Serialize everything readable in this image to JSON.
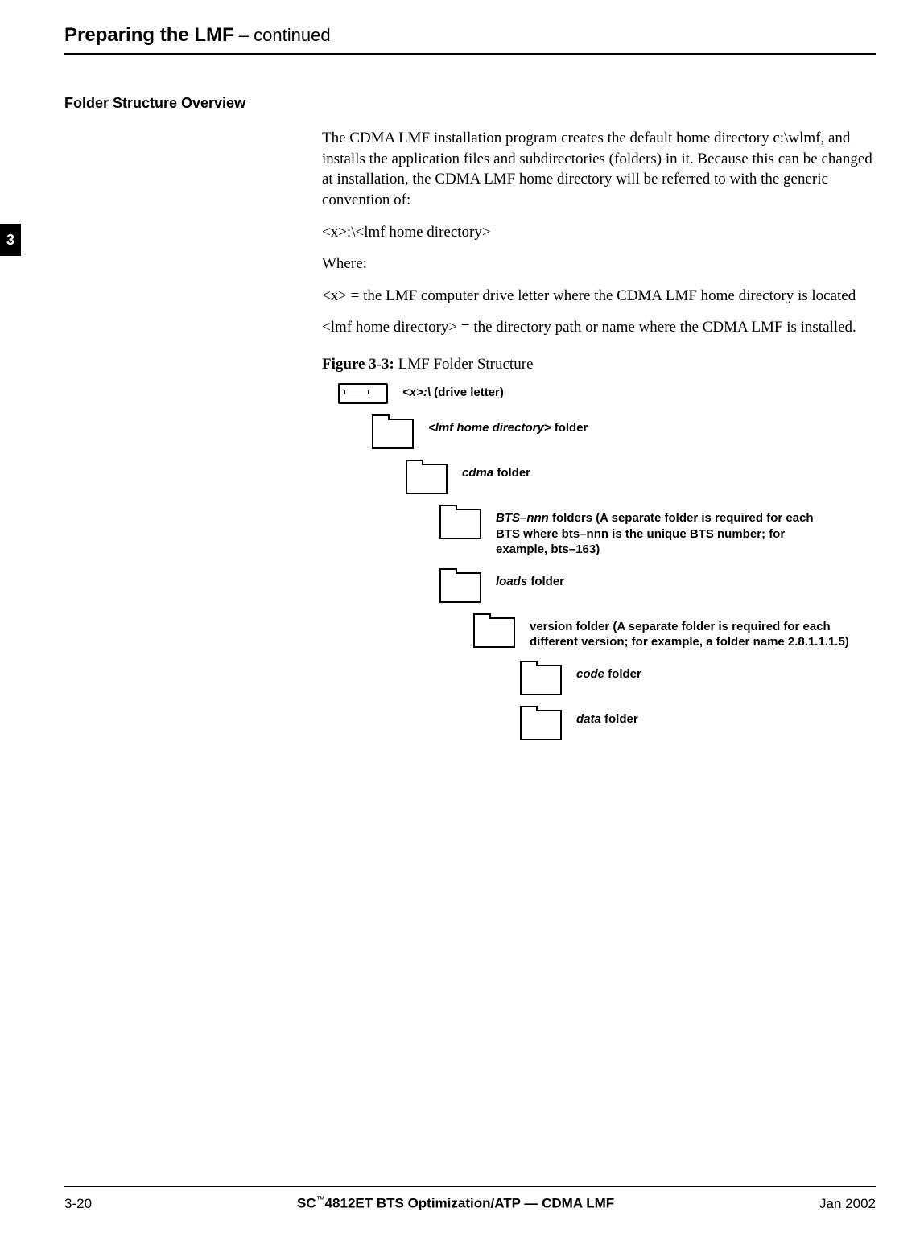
{
  "header": {
    "title": "Preparing the LMF",
    "continued": "  – continued"
  },
  "chapter_tab": "3",
  "section": {
    "title": "Folder Structure Overview",
    "p1": "The CDMA LMF installation program creates the default home directory c:\\wlmf, and installs the application files and subdirectories (folders) in it. Because this can be changed at installation, the CDMA LMF home directory will be referred to with the generic convention of:",
    "p2": "<x>:\\<lmf home directory>",
    "p3": "Where:",
    "p4": "<x> = the LMF computer drive letter where the CDMA LMF home directory is located",
    "p5": "<lmf home directory> = the directory path or name where the CDMA LMF is installed."
  },
  "figure": {
    "caption_bold": "Figure 3-3:",
    "caption_rest": " LMF Folder Structure",
    "nodes": {
      "drive": {
        "italic": "<x>:\\ ",
        "rest": " (drive letter)"
      },
      "lmf": {
        "italic": "<lmf home directory>",
        "rest": " folder"
      },
      "cdma": {
        "italic": "cdma",
        "rest": " folder"
      },
      "bts": {
        "italic": "BTS–nnn",
        "rest": " folders (A separate folder is required for each BTS where bts–nnn is the unique BTS number; for example, bts–163)"
      },
      "loads": {
        "italic": "loads",
        "rest": " folder"
      },
      "version": {
        "italic": "",
        "rest": "version folder (A separate folder is required for each different version; for example, a folder name 2.8.1.1.1.5)"
      },
      "code": {
        "italic": "code",
        "rest": " folder"
      },
      "data": {
        "italic": "data",
        "rest": " folder"
      }
    }
  },
  "footer": {
    "page": "3-20",
    "center_prefix": "SC",
    "center_tm": "™",
    "center_suffix": "4812ET BTS Optimization/ATP — CDMA LMF",
    "date": "Jan 2002"
  }
}
